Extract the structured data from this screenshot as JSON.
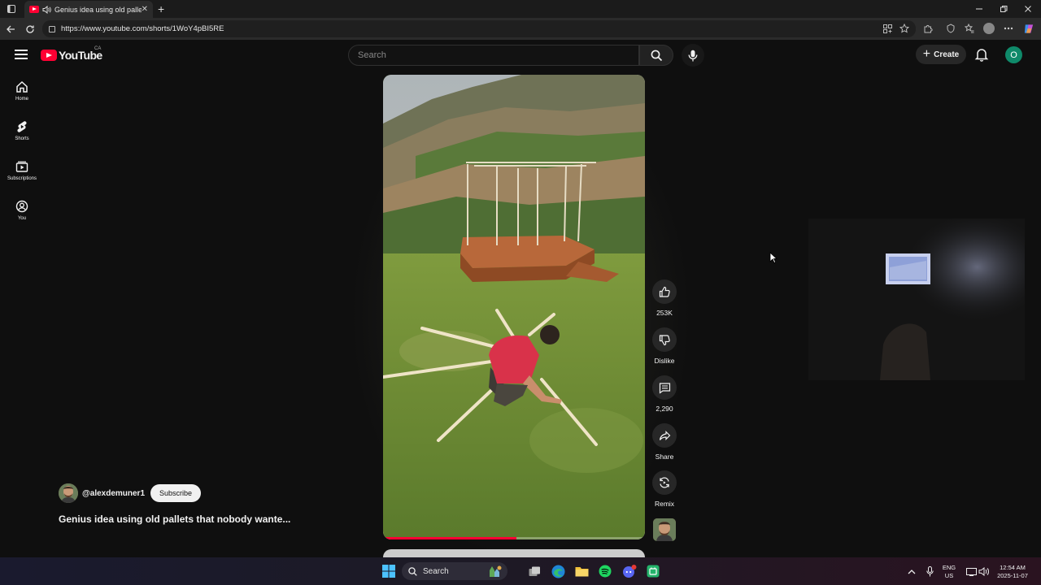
{
  "browser": {
    "tab_title": "Genius idea using old palle...",
    "tab_close": "✕",
    "new_tab": "+",
    "url": "https://www.youtube.com/shorts/1WoY4pBI5RE"
  },
  "masthead": {
    "logo_text": "YouTube",
    "region": "CA",
    "search_placeholder": "Search",
    "create_label": "Create",
    "avatar_letter": "O"
  },
  "guide": {
    "items": [
      {
        "label": "Home",
        "icon": "home-icon"
      },
      {
        "label": "Shorts",
        "icon": "shorts-icon"
      },
      {
        "label": "Subscriptions",
        "icon": "subscriptions-icon"
      },
      {
        "label": "You",
        "icon": "you-icon"
      }
    ]
  },
  "short": {
    "channel": "@alexdemuner1",
    "subscribe_label": "Subscribe",
    "title": "Genius idea using old pallets that nobody wante...",
    "progress": 0.51,
    "actions": {
      "like": "253K",
      "dislike": "Dislike",
      "comments": "2,290",
      "share": "Share",
      "remix": "Remix"
    }
  },
  "taskbar": {
    "search_label": "Search",
    "lang": "ENG",
    "region": "US",
    "time": "12:54 AM",
    "date": "2025-11-07"
  },
  "colors": {
    "brand_red": "#ff0033",
    "background": "#0f0f0f",
    "avatar_bg": "#0f8a6a"
  }
}
